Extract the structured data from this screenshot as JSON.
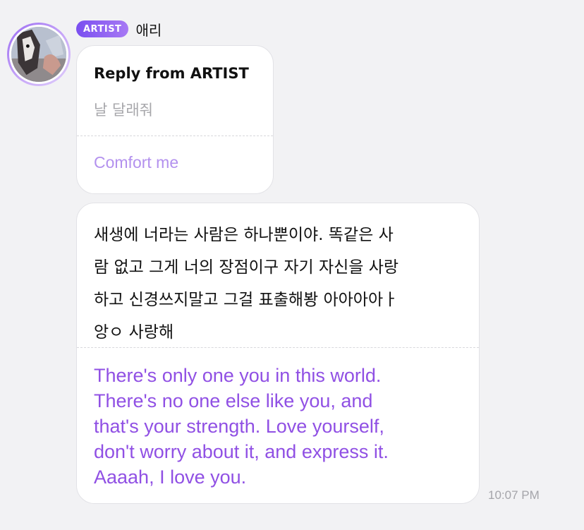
{
  "sender": {
    "badge": "ARTIST",
    "name": "애리"
  },
  "reply": {
    "title": "Reply from ARTIST",
    "original": "날 달래줘",
    "translation": "Comfort me"
  },
  "message": {
    "lines": [
      "새생에 너라는 사람은 하나뿐이야. 똑같은 사",
      "람 없고 그게 너의 장점이구 자기 자신을 사랑",
      "하고 신경쓰지말고 그걸 표출해봥 아아아아ㅏ",
      "앙ㅇ 사랑해"
    ],
    "translation_lines": [
      "There's only one you in this world.",
      "There's no one else like you, and",
      "that's your strength. Love yourself,",
      "don't worry about it, and express it.",
      "Aaaah, I love you."
    ]
  },
  "timestamp": "10:07 PM",
  "colors": {
    "badge_gradient_start": "#7a4ff0",
    "badge_gradient_end": "#a779f4",
    "reply_translation": "#b391ee",
    "message_translation": "#9050e4",
    "background": "#f2f2f4"
  }
}
